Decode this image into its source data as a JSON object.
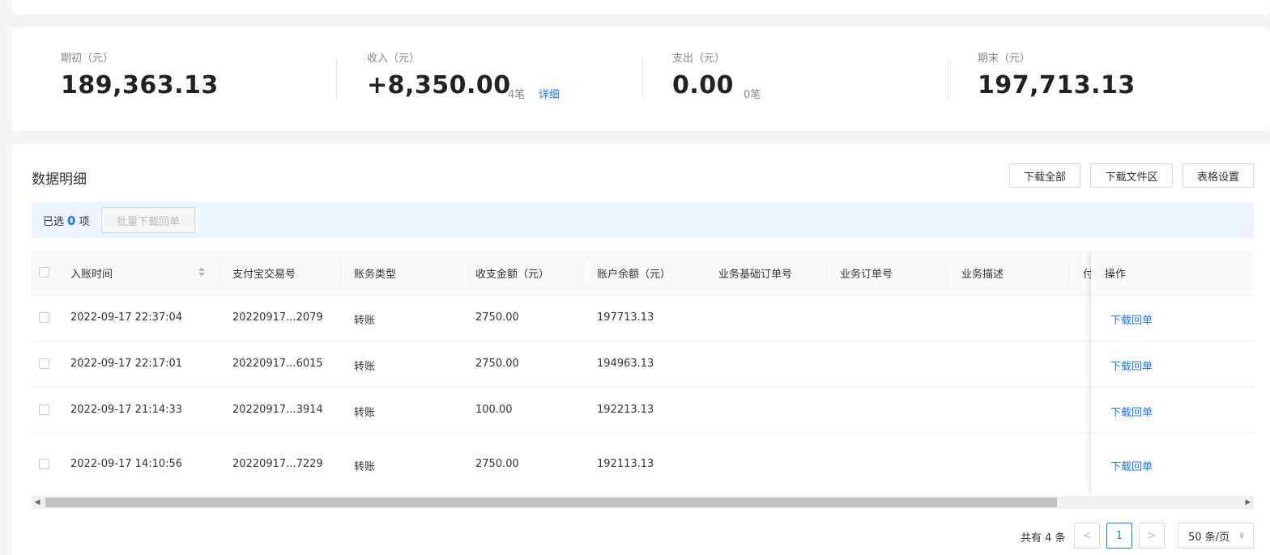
{
  "summary": {
    "opening": {
      "label": "期初（元）",
      "value": "189,363.13"
    },
    "income": {
      "label": "收入（元）",
      "value": "+8,350.00",
      "count": "4笔",
      "link": "详细"
    },
    "expense": {
      "label": "支出（元）",
      "value": "0.00",
      "count": "0笔"
    },
    "closing": {
      "label": "期末（元）",
      "value": "197,713.13"
    }
  },
  "detail": {
    "title": "数据明细",
    "buttons": {
      "download_all": "下载全部",
      "download_area": "下载文件区",
      "table_settings": "表格设置"
    },
    "selection": {
      "prefix": "已选",
      "count": "0",
      "suffix": "项",
      "batch_button": "批量下载回单"
    }
  },
  "table": {
    "columns": [
      "入账时间",
      "支付宝交易号",
      "账务类型",
      "收支金额（元）",
      "账户余额（元）",
      "业务基础订单号",
      "业务订单号",
      "业务描述",
      "付",
      "操作"
    ],
    "rows": [
      {
        "time": "2022-09-17 22:37:04",
        "trade_no": "20220917...2079",
        "type": "转账",
        "amount": "2750.00",
        "balance": "197713.13",
        "action": "下载回单"
      },
      {
        "time": "2022-09-17 22:17:01",
        "trade_no": "20220917...6015",
        "type": "转账",
        "amount": "2750.00",
        "balance": "194963.13",
        "action": "下载回单"
      },
      {
        "time": "2022-09-17 21:14:33",
        "trade_no": "20220917...3914",
        "type": "转账",
        "amount": "100.00",
        "balance": "192213.13",
        "action": "下载回单"
      },
      {
        "time": "2022-09-17 14:10:56",
        "trade_no": "20220917...7229",
        "type": "转账",
        "amount": "2750.00",
        "balance": "192113.13",
        "action": "下载回单"
      }
    ]
  },
  "pagination": {
    "total": "共有 4 条",
    "prev": "<",
    "current": "1",
    "next": ">",
    "page_size": "50 条/页"
  },
  "icons": {
    "sort": "sort-icon",
    "chevron_down": "chevron-down-icon",
    "scroll_left": "arrow-left-icon",
    "scroll_right": "arrow-right-icon"
  },
  "colors": {
    "accent": "#1677ff",
    "selection_bg": "#eef5ff"
  }
}
